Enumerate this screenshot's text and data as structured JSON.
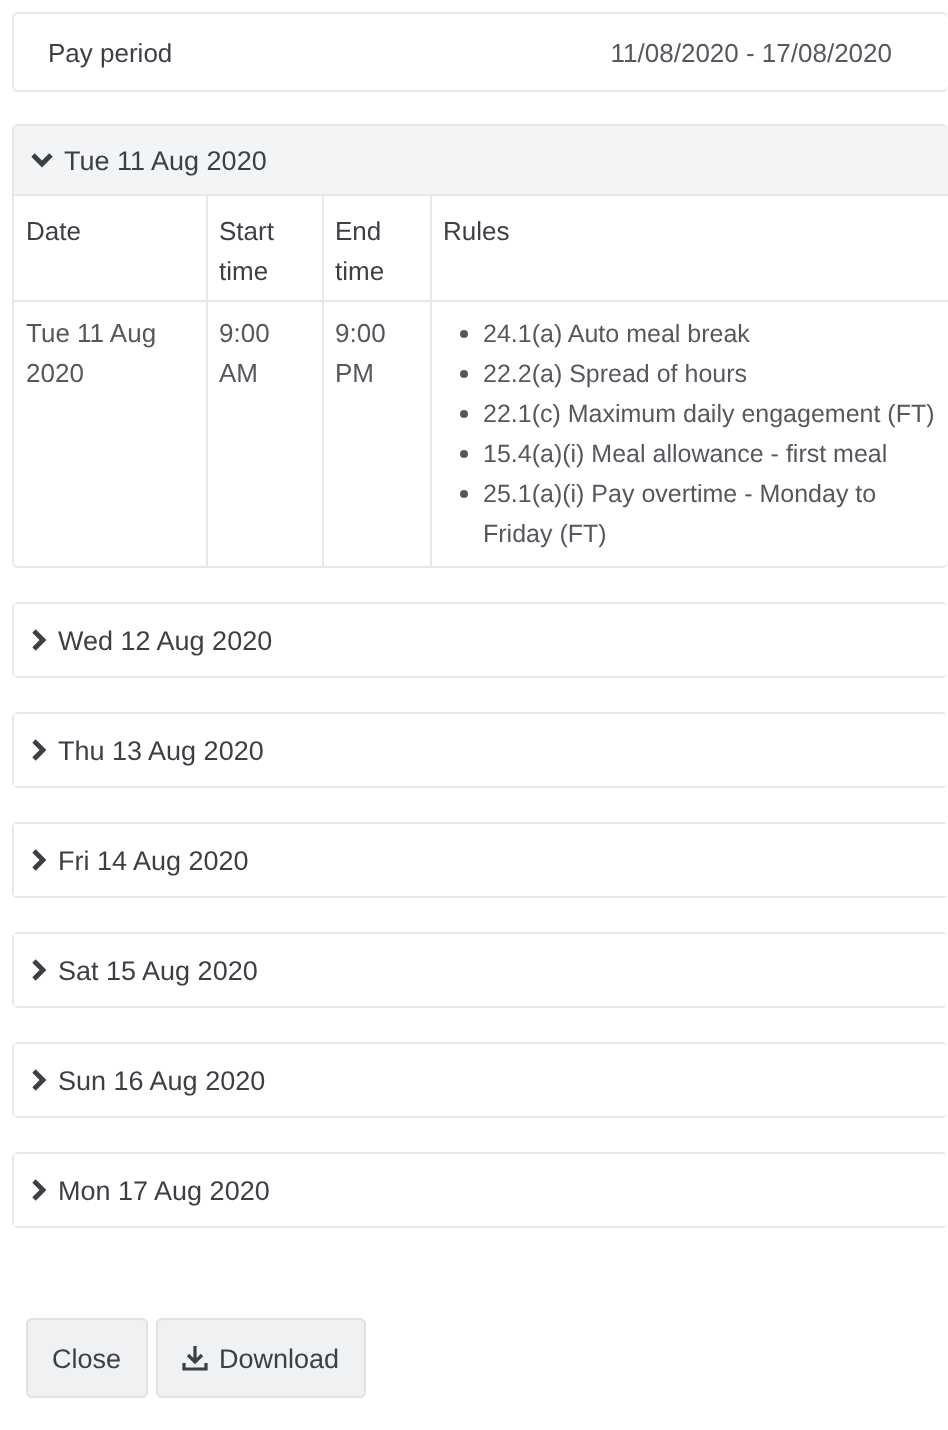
{
  "pay_period": {
    "label": "Pay period",
    "value": "11/08/2020 - 17/08/2020"
  },
  "days": [
    {
      "title": "Tue 11 Aug 2020",
      "expanded": true,
      "table": {
        "columns": [
          "Date",
          "Start time",
          "End time",
          "Rules"
        ],
        "rows": [
          {
            "date": "Tue 11 Aug 2020",
            "start": "9:00 AM",
            "end": "9:00 PM",
            "rules": [
              "24.1(a) Auto meal break",
              "22.2(a) Spread of hours",
              "22.1(c) Maximum daily engagement (FT)",
              "15.4(a)(i) Meal allowance - first meal",
              "25.1(a)(i) Pay overtime - Monday to Friday (FT)"
            ]
          }
        ]
      }
    },
    {
      "title": "Wed 12 Aug 2020",
      "expanded": false
    },
    {
      "title": "Thu 13 Aug 2020",
      "expanded": false
    },
    {
      "title": "Fri 14 Aug 2020",
      "expanded": false
    },
    {
      "title": "Sat 15 Aug 2020",
      "expanded": false
    },
    {
      "title": "Sun 16 Aug 2020",
      "expanded": false
    },
    {
      "title": "Mon 17 Aug 2020",
      "expanded": false
    }
  ],
  "buttons": [
    {
      "label": "Close",
      "kind": "plain"
    },
    {
      "label": "Download",
      "kind": "download"
    }
  ]
}
